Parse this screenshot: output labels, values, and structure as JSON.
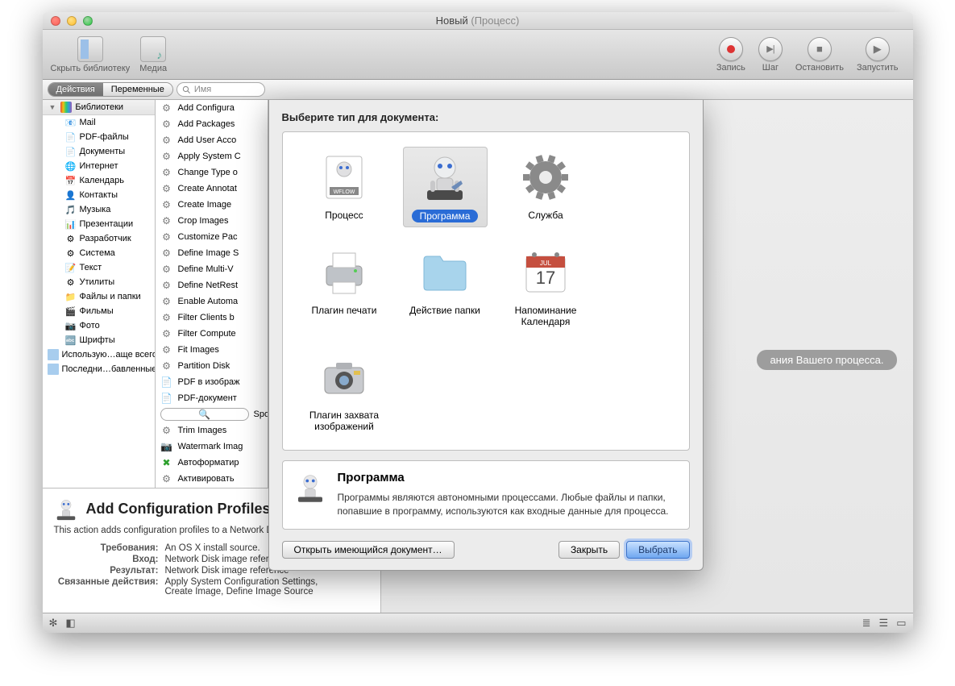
{
  "window": {
    "title": "Новый",
    "subtitle": "(Процесс)"
  },
  "toolbar": {
    "hideLibrary": "Скрыть библиотеку",
    "media": "Медиа",
    "record": "Запись",
    "step": "Шаг",
    "stop": "Остановить",
    "run": "Запустить"
  },
  "segbar": {
    "actions": "Действия",
    "variables": "Переменные",
    "searchPlaceholder": "Имя"
  },
  "sidebar": {
    "library": "Библиотеки",
    "items": [
      "Mail",
      "PDF-файлы",
      "Документы",
      "Интернет",
      "Календарь",
      "Контакты",
      "Музыка",
      "Презентации",
      "Разработчик",
      "Система",
      "Текст",
      "Утилиты",
      "Файлы и папки",
      "Фильмы",
      "Фото",
      "Шрифты"
    ],
    "mostUsed": "Использую…аще всего",
    "recent": "Последни…бавленные"
  },
  "actions": [
    "Add Configura",
    "Add Packages",
    "Add User Acco",
    "Apply System C",
    "Change Type o",
    "Create Annotat",
    "Create Image",
    "Crop Images",
    "Customize Pac",
    "Define Image S",
    "Define Multi-V",
    "Define NetRest",
    "Enable Automa",
    "Filter Clients b",
    "Filter Compute",
    "Fit Images",
    "Partition Disk",
    "PDF в изображ",
    "PDF-документ",
    "Spotlight",
    "Trim Images",
    "Watermark Imag",
    "Автоформатир",
    "Активировать"
  ],
  "workspaceHint": "ания Вашего процесса.",
  "infoPanel": {
    "title": "Add Configuration Profiles",
    "desc": "This action adds configuration profiles to a Network Disk image.",
    "rows": {
      "req_k": "Требования:",
      "req_v": "An OS X install source.",
      "in_k": "Вход:",
      "in_v": "Network Disk image reference",
      "out_k": "Результат:",
      "out_v": "Network Disk image reference",
      "rel_k": "Связанные действия:",
      "rel_v": "Apply System Configuration Settings, Create Image, Define Image Source"
    }
  },
  "dialog": {
    "prompt": "Выберите тип для документа:",
    "types": [
      {
        "label": "Процесс",
        "icon": "wflow"
      },
      {
        "label": "Программа",
        "icon": "robot",
        "selected": true
      },
      {
        "label": "Служба",
        "icon": "gear"
      },
      {
        "label": "Плагин печати",
        "icon": "printer"
      },
      {
        "label": "Действие папки",
        "icon": "folder"
      },
      {
        "label": "Напоминание Календаря",
        "icon": "calendar"
      },
      {
        "label": "Плагин захвата изображений",
        "icon": "camera"
      }
    ],
    "selectedTitle": "Программа",
    "selectedDesc": "Программы являются автономными процессами. Любые файлы и папки, попавшие в программу, используются как входные данные для процесса.",
    "openExisting": "Открыть имеющийся документ…",
    "close": "Закрыть",
    "choose": "Выбрать"
  }
}
